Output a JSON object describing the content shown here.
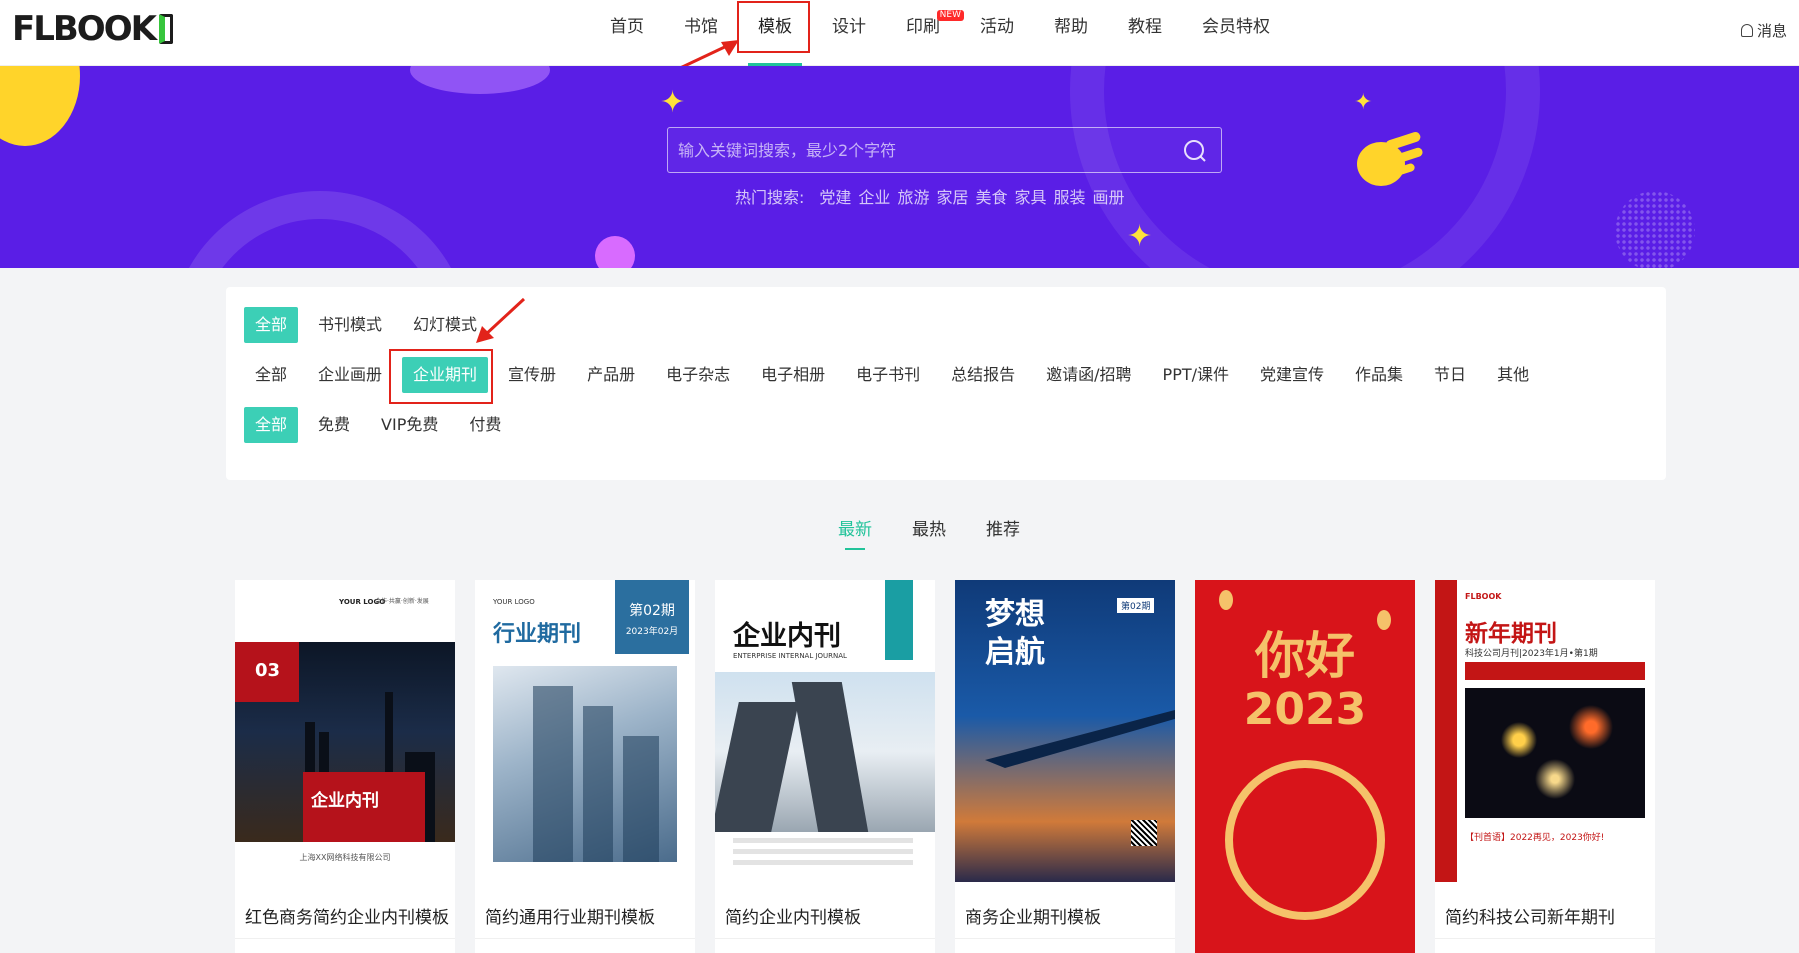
{
  "header": {
    "logo_text": "FLBOOK",
    "nav": [
      {
        "label": "首页"
      },
      {
        "label": "书馆"
      },
      {
        "label": "模板",
        "active": true
      },
      {
        "label": "设计"
      },
      {
        "label": "印刷",
        "badge": "NEW"
      },
      {
        "label": "活动"
      },
      {
        "label": "帮助"
      },
      {
        "label": "教程"
      },
      {
        "label": "会员特权"
      }
    ],
    "message_label": "消息"
  },
  "banner": {
    "search_placeholder": "输入关键词搜索，最少2个字符",
    "hot_label": "热门搜索:",
    "hot_words": [
      "党建",
      "企业",
      "旅游",
      "家居",
      "美食",
      "家具",
      "服装",
      "画册"
    ]
  },
  "filters": {
    "mode": {
      "items": [
        "全部",
        "书刊模式",
        "幻灯模式"
      ],
      "selected": 0
    },
    "category": {
      "items": [
        "全部",
        "企业画册",
        "企业期刊",
        "宣传册",
        "产品册",
        "电子杂志",
        "电子相册",
        "电子书刊",
        "总结报告",
        "邀请函/招聘",
        "PPT/课件",
        "党建宣传",
        "作品集",
        "节日",
        "其他"
      ],
      "selected": 2
    },
    "price": {
      "items": [
        "全部",
        "免费",
        "VIP免费",
        "付费"
      ],
      "selected": 0
    }
  },
  "sort_tabs": {
    "items": [
      "最新",
      "最热",
      "推荐"
    ],
    "selected": 0
  },
  "cards": [
    {
      "title": "红色商务简约企业内刊模板",
      "cover": {
        "logo": "YOUR LOGO",
        "slogan": "合作·共赢·创新·发展",
        "issue": "03",
        "heading": "企业内刊",
        "footer": "上海XX网络科技有限公司"
      }
    },
    {
      "title": "简约通用行业期刊模板",
      "cover": {
        "logo": "YOUR LOGO",
        "heading": "行业期刊",
        "issue": "第02期",
        "date": "2023年02月"
      }
    },
    {
      "title": "简约企业内刊模板",
      "cover": {
        "heading": "企业内刊",
        "sub": "ENTERPRISE INTERNAL JOURNAL"
      }
    },
    {
      "title": "商务企业期刊模板",
      "cover": {
        "heading": "梦想启航",
        "issue": "第02期"
      }
    },
    {
      "title": "",
      "cover": {
        "heading": "你好",
        "year": "2023"
      }
    },
    {
      "title": "简约科技公司新年期刊",
      "cover": {
        "brand": "FLBOOK",
        "heading": "新年期刊",
        "sub": "科技公司月刊|2023年1月•第1期",
        "footer": "【刊首语】2022再见，2023你好!"
      }
    }
  ],
  "colors": {
    "accent": "#3ccfb6",
    "banner": "#5a1ee6",
    "highlight_box": "#e2231a"
  }
}
